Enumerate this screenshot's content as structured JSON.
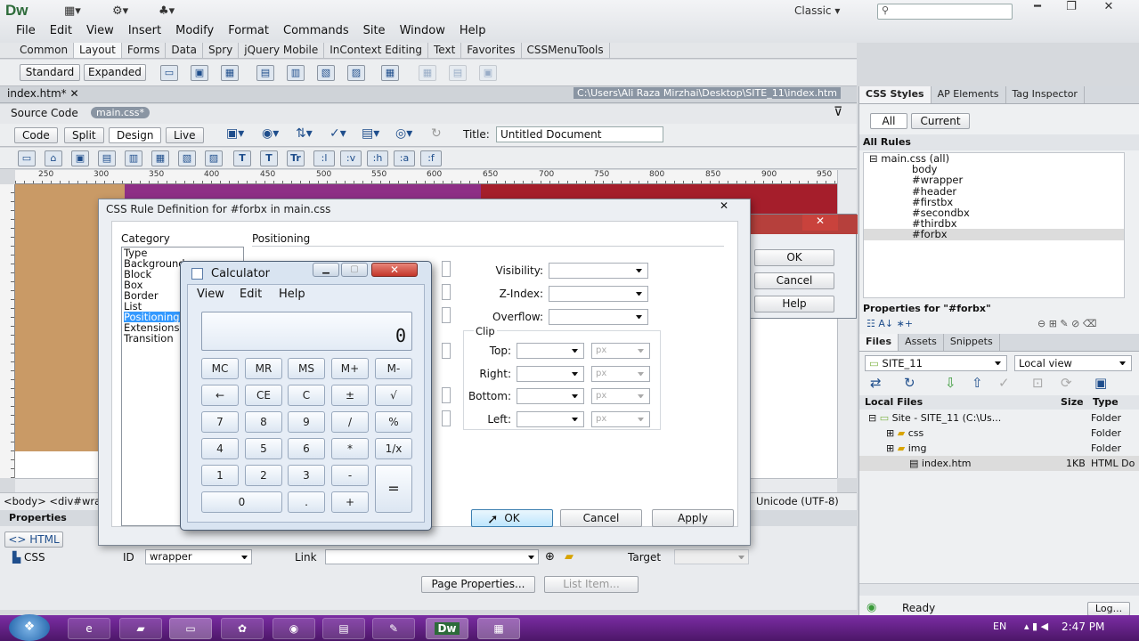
{
  "app": {
    "logo": "Dw",
    "workspace": "Classic",
    "search_placeholder": ""
  },
  "menu": [
    "File",
    "Edit",
    "View",
    "Insert",
    "Modify",
    "Format",
    "Commands",
    "Site",
    "Window",
    "Help"
  ],
  "insert_tabs": [
    "Common",
    "Layout",
    "Forms",
    "Data",
    "Spry",
    "jQuery Mobile",
    "InContext Editing",
    "Text",
    "Favorites",
    "CSSMenuTools"
  ],
  "layout_buttons": {
    "standard": "Standard",
    "expanded": "Expanded"
  },
  "document": {
    "tab": "index.htm*",
    "path": "C:\\Users\\Ali Raza Mirzhai\\Desktop\\SITE_11\\index.htm",
    "source_code": "Source Code",
    "related_file": "main.css*",
    "title_label": "Title:",
    "title_value": "Untitled Document"
  },
  "view_buttons": [
    "Code",
    "Split",
    "Design",
    "Live"
  ],
  "format_buttons": [
    ":l",
    ":v",
    ":h",
    ":a",
    ":f"
  ],
  "ruler_ticks": [
    "250",
    "300",
    "350",
    "400",
    "450",
    "500",
    "550",
    "600",
    "650",
    "700",
    "750",
    "800",
    "850",
    "900",
    "950"
  ],
  "status": {
    "tag_selector": "<body> <div#wra",
    "encoding": "Unicode (UTF-8)"
  },
  "properties": {
    "title": "Properties",
    "html_btn": "HTML",
    "css_btn": "CSS",
    "id_label": "ID",
    "id_value": "wrapper",
    "link_label": "Link",
    "target_label": "Target",
    "page_props": "Page Properties...",
    "list_item": "List Item..."
  },
  "css_panel": {
    "tabs": [
      "CSS Styles",
      "AP Elements",
      "Tag Inspector"
    ],
    "all_btn": "All",
    "current_btn": "Current",
    "all_rules": "All Rules",
    "sheet": "main.css (all)",
    "rules": [
      "body",
      "#wrapper",
      "#header",
      "#firstbx",
      "#secondbx",
      "#thirdbx",
      "#forbx"
    ],
    "props_for": "Properties for \"#forbx\""
  },
  "files_panel": {
    "tabs": [
      "Files",
      "Assets",
      "Snippets"
    ],
    "site": "SITE_11",
    "view": "Local view",
    "col_local": "Local Files",
    "col_size": "Size",
    "col_type": "Type",
    "rows": [
      {
        "name": "Site - SITE_11 (C:\\Us...",
        "size": "",
        "type": "Folder"
      },
      {
        "name": "css",
        "size": "",
        "type": "Folder"
      },
      {
        "name": "img",
        "size": "",
        "type": "Folder"
      },
      {
        "name": "index.htm",
        "size": "1KB",
        "type": "HTML Do"
      }
    ],
    "ready": "Ready",
    "log": "Log..."
  },
  "css_dialog": {
    "title": "CSS Rule Definition for #forbx in main.css",
    "category_label": "Category",
    "section": "Positioning",
    "categories": [
      "Type",
      "Background",
      "Block",
      "Box",
      "Border",
      "List",
      "Positioning",
      "Extensions",
      "Transition"
    ],
    "visibility": "Visibility:",
    "zindex": "Z-Index:",
    "overflow": "Overflow:",
    "clip": "Clip",
    "top": "Top:",
    "right": "Right:",
    "bottom": "Bottom:",
    "left": "Left:",
    "unit": "px",
    "ok": "OK",
    "cancel": "Cancel",
    "apply": "Apply"
  },
  "side_dialog": {
    "ok": "OK",
    "cancel": "Cancel",
    "help": "Help"
  },
  "calculator": {
    "title": "Calculator",
    "menu": [
      "View",
      "Edit",
      "Help"
    ],
    "display": "0",
    "rows": [
      [
        "MC",
        "MR",
        "MS",
        "M+",
        "M-"
      ],
      [
        "←",
        "CE",
        "C",
        "±",
        "√"
      ],
      [
        "7",
        "8",
        "9",
        "/",
        "%"
      ],
      [
        "4",
        "5",
        "6",
        "*",
        "1/x"
      ],
      [
        "1",
        "2",
        "3",
        "-"
      ]
    ],
    "zero": "0",
    "dot": ".",
    "plus": "+",
    "equals": "="
  },
  "taskbar": {
    "lang": "EN",
    "time": "2:47 PM"
  },
  "colors": {
    "canvas_orange": "#c99a66",
    "canvas_purple": "#8e2f86",
    "canvas_red": "#a51e2b",
    "taskbar": "#5e1e80"
  }
}
